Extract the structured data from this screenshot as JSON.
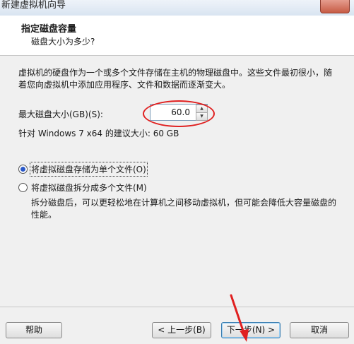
{
  "window": {
    "title": "新建虚拟机向导"
  },
  "header": {
    "title": "指定磁盘容量",
    "subtitle": "磁盘大小为多少?"
  },
  "main": {
    "description": "虚拟机的硬盘作为一个或多个文件存储在主机的物理磁盘中。这些文件最初很小，随着您向虚拟机中添加应用程序、文件和数据而逐渐变大。",
    "max_disk_label": "最大磁盘大小(GB)(S):",
    "max_disk_value": "60.0",
    "recommend_text": "针对 Windows 7 x64 的建议大小: 60 GB",
    "options": [
      {
        "label": "将虚拟磁盘存储为单个文件(O)",
        "selected": true
      },
      {
        "label": "将虚拟磁盘拆分成多个文件(M)",
        "selected": false
      }
    ],
    "split_description": "拆分磁盘后，可以更轻松地在计算机之间移动虚拟机，但可能会降低大容量磁盘的性能。"
  },
  "footer": {
    "help": "帮助",
    "back": "< 上一步(B)",
    "next": "下一步(N) >",
    "cancel": "取消"
  },
  "colors": {
    "annotation": "#e02020",
    "accent": "#2a58c8"
  }
}
